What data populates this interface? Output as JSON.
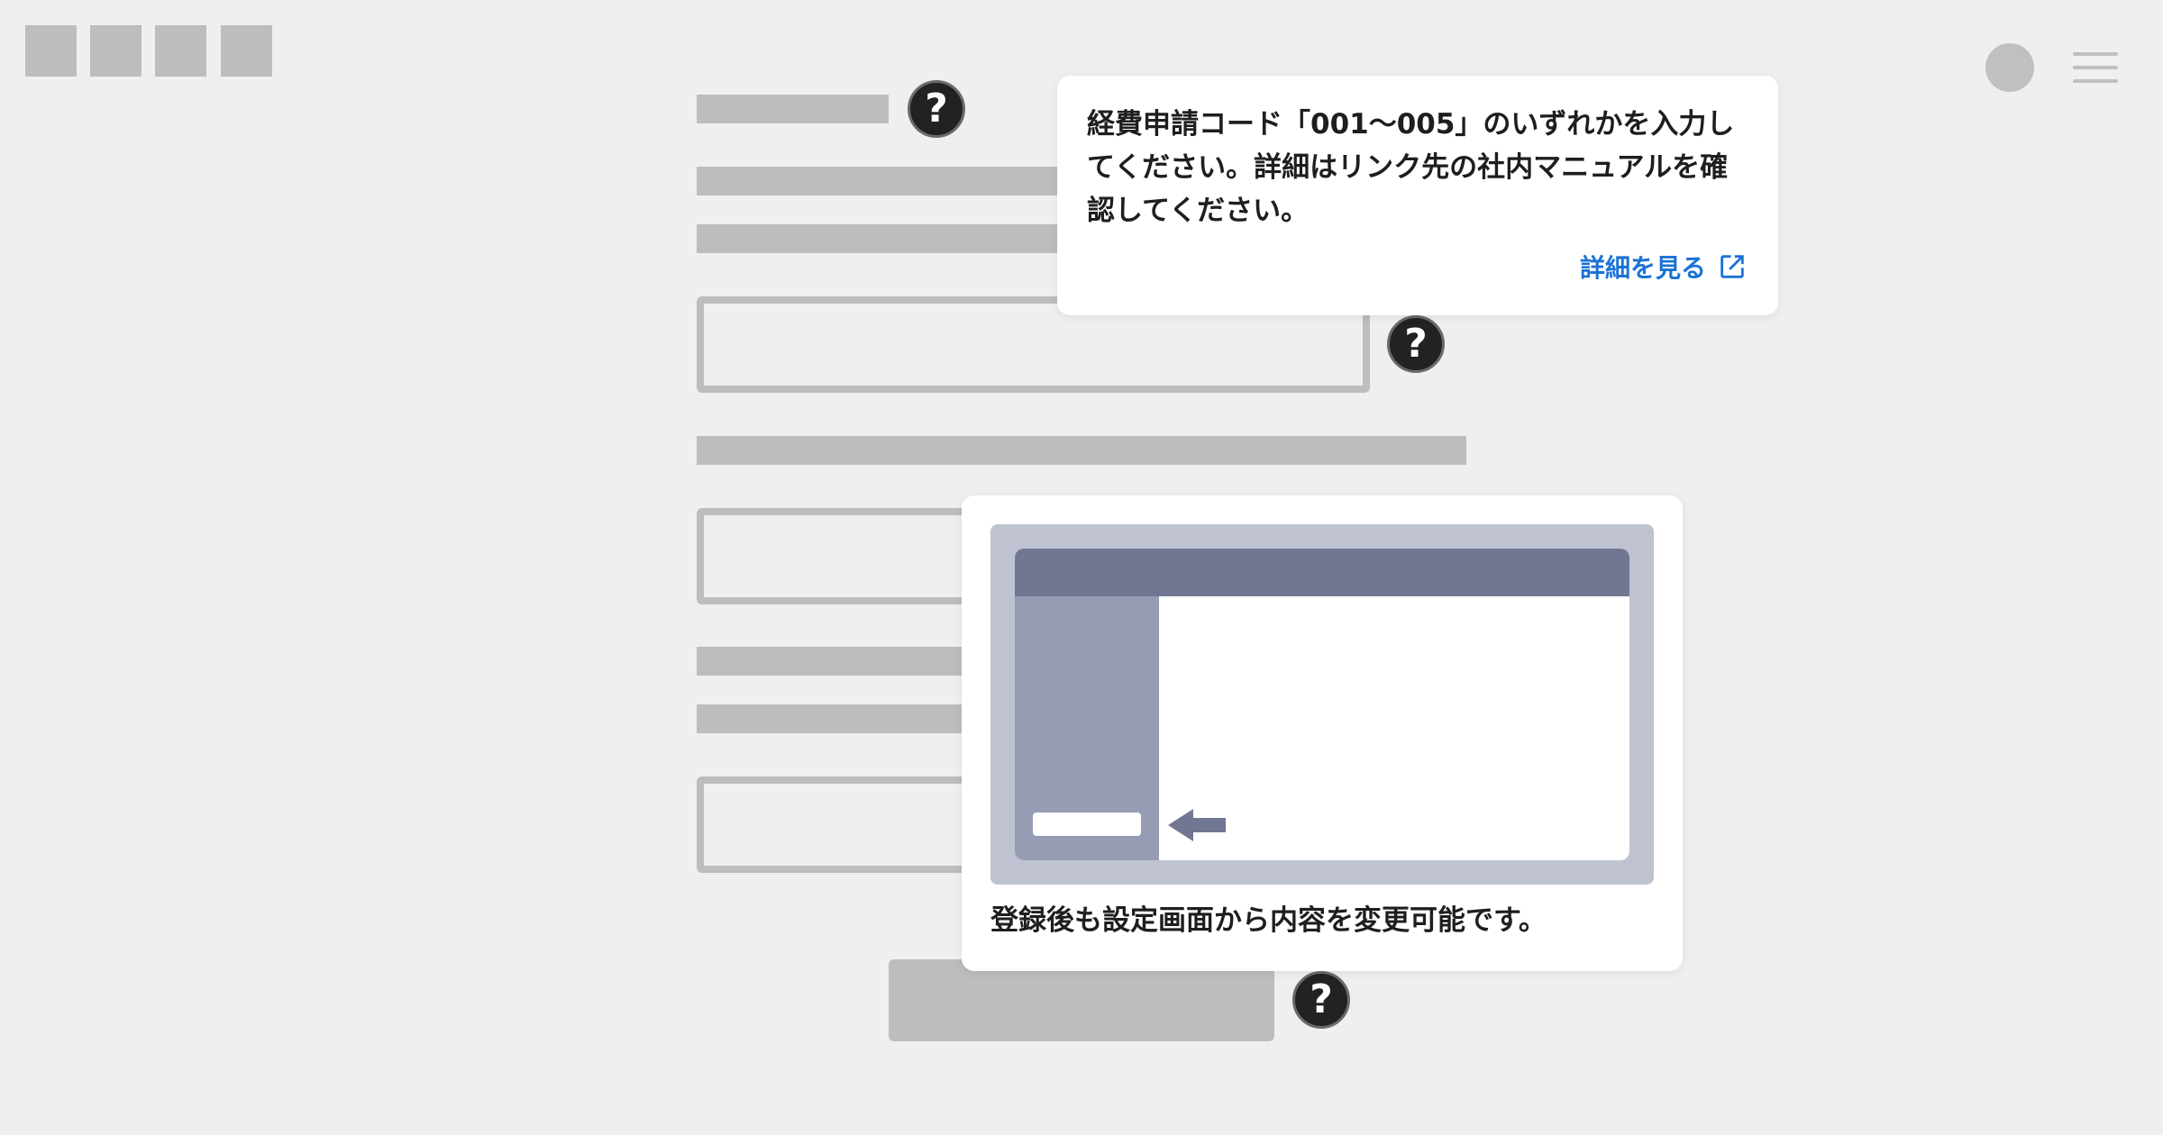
{
  "header": {
    "logo_icon": "logo-placeholder-blocks",
    "avatar_icon": "avatar-circle",
    "menu_icon": "hamburger-menu-icon"
  },
  "help_icon_glyph": "?",
  "tooltip_code": {
    "text": "経費申請コード「001〜005」のいずれかを入力してください。詳細はリンク先の社内マニュアルを確認してください。",
    "link_label": "詳細を見る",
    "link_icon": "external-link-icon"
  },
  "tooltip_settings": {
    "caption": "登録後も設定画面から内容を変更可能です。",
    "illustration": "settings-screen-illustration"
  },
  "colors": {
    "background": "#efefef",
    "placeholder": "#bdbdbd",
    "help_icon": "#222222",
    "link": "#1b72d6",
    "illustration_frame": "#bfc3d1",
    "illustration_header": "#717793",
    "illustration_sidebar": "#969cb4"
  }
}
